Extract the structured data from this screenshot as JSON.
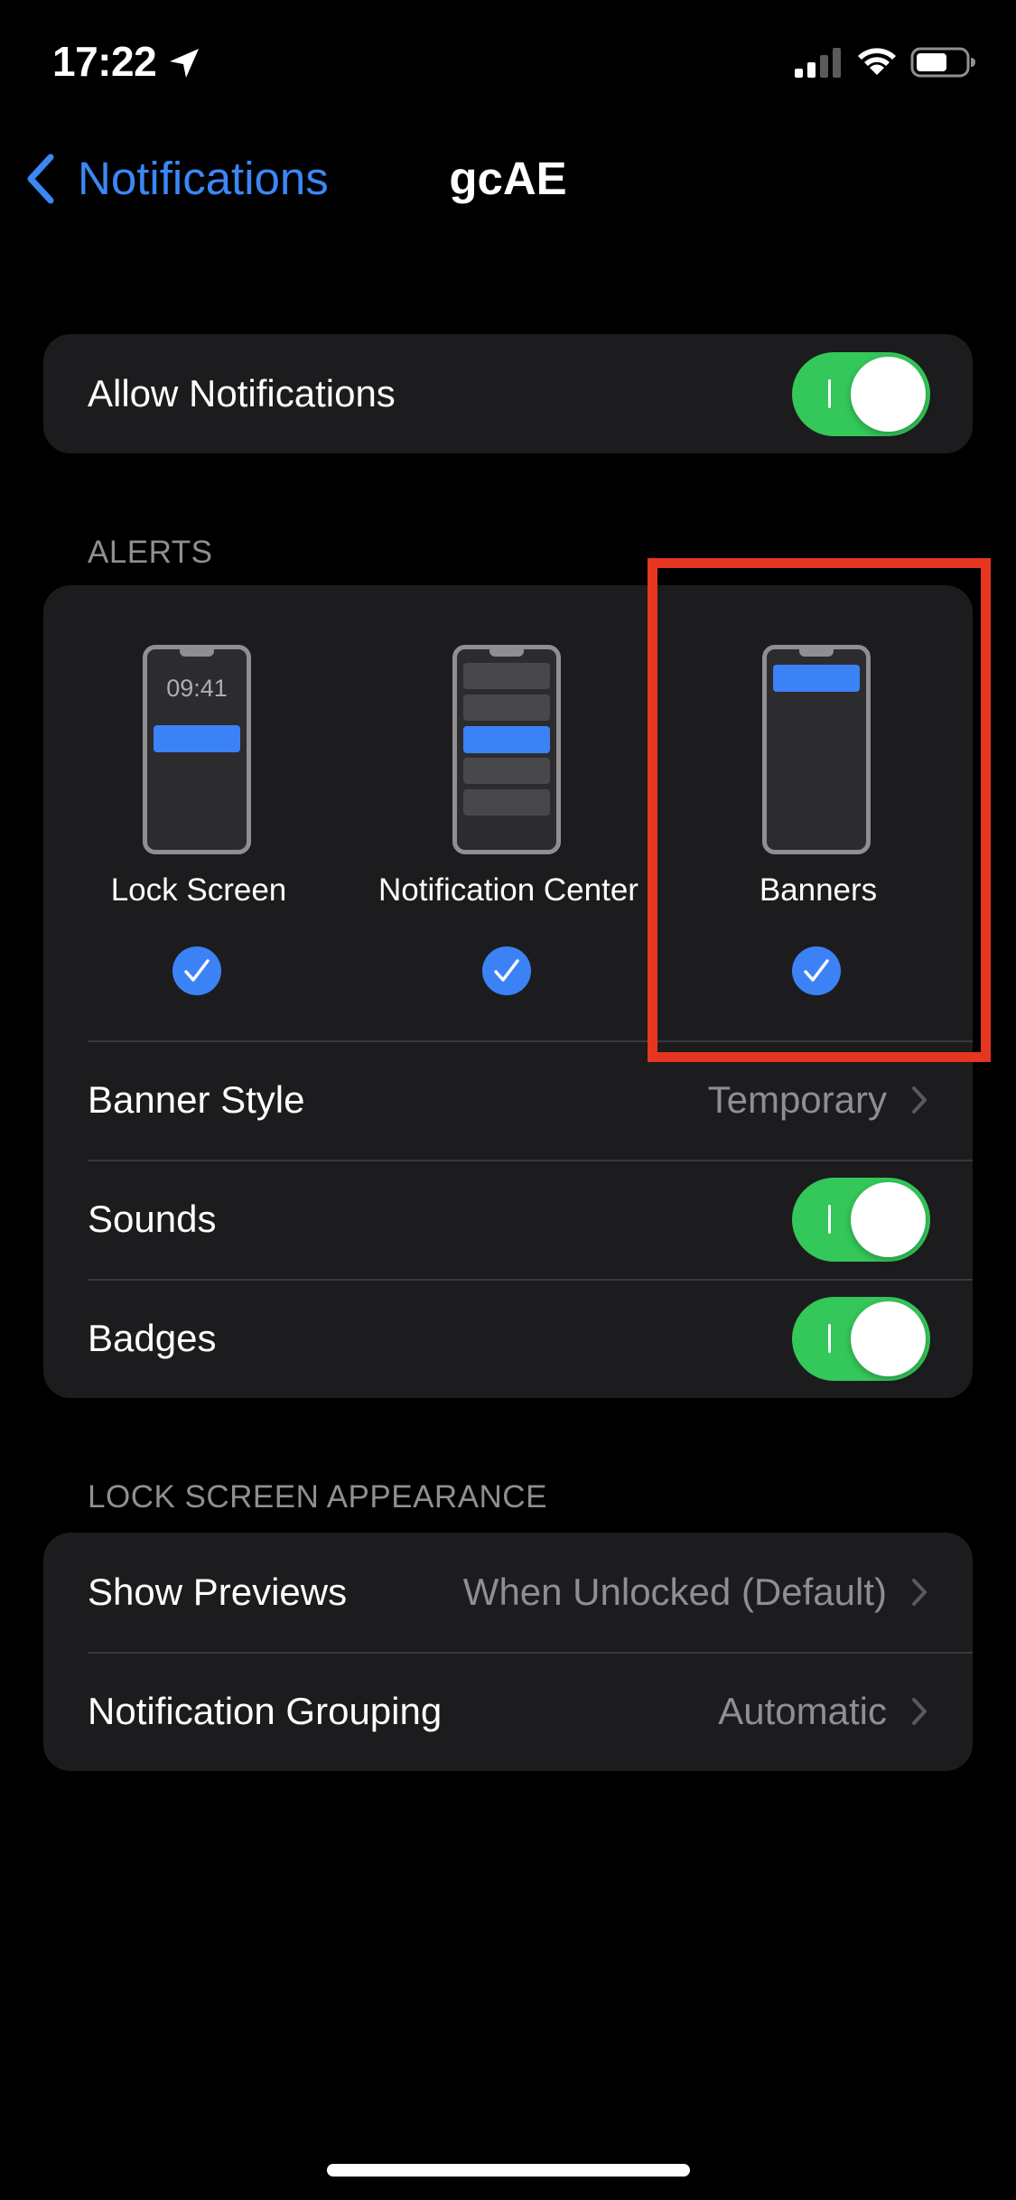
{
  "status_bar": {
    "time": "17:22"
  },
  "nav": {
    "back_label": "Notifications",
    "title": "gcAE"
  },
  "allow_notifications": {
    "label": "Allow Notifications",
    "enabled": true
  },
  "alerts": {
    "header": "ALERTS",
    "options": [
      {
        "label": "Lock Screen",
        "selected": true,
        "preview_time": "09:41"
      },
      {
        "label": "Notification Center",
        "selected": true
      },
      {
        "label": "Banners",
        "selected": true
      }
    ],
    "banner_style": {
      "label": "Banner Style",
      "value": "Temporary"
    },
    "sounds": {
      "label": "Sounds",
      "enabled": true
    },
    "badges": {
      "label": "Badges",
      "enabled": true
    }
  },
  "lock_screen_appearance": {
    "header": "LOCK SCREEN APPEARANCE",
    "show_previews": {
      "label": "Show Previews",
      "value": "When Unlocked (Default)"
    },
    "notification_grouping": {
      "label": "Notification Grouping",
      "value": "Automatic"
    }
  },
  "colors": {
    "accent": "#3b87f5",
    "toggle_on": "#34c759",
    "highlight": "#e5361f",
    "group_background": "#1c1c1e"
  },
  "icons": {
    "back": "chevron-left-icon",
    "disclosure": "chevron-right-icon",
    "check": "checkmark-icon",
    "location": "location-arrow-icon",
    "signal": "cellular-signal-icon",
    "wifi": "wifi-icon",
    "battery": "battery-icon"
  }
}
